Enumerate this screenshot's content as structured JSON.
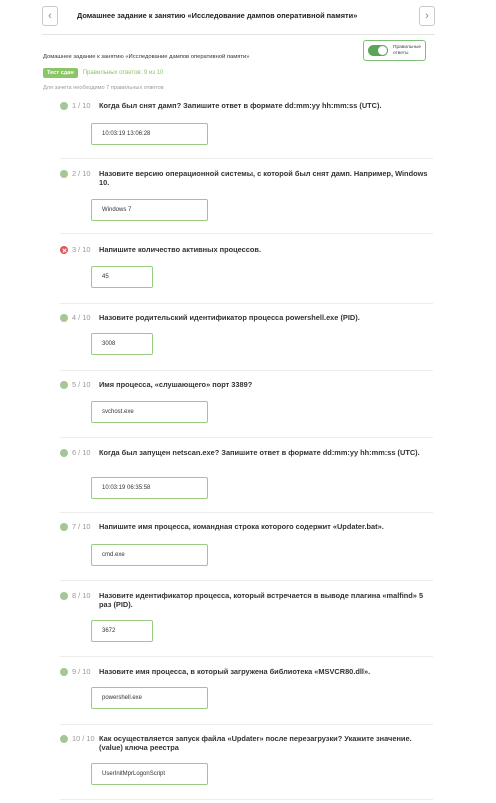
{
  "header": {
    "prev_icon": "chevron-left-icon",
    "next_icon": "chevron-right-icon",
    "title": "Домашнее задание к занятию «Исследование дампов оперативной памяти»"
  },
  "subtitle": "Домашнее задание к занятию «Исследование дампов оперативной памяти»",
  "toggle": {
    "label": "Правильные ответы",
    "on": true,
    "color": "#5aa55a"
  },
  "status": {
    "badge": "Тест сдан",
    "correct": "Правильных ответов: 9 из 10",
    "note": "Для зачета необходимо 7 правильных ответов"
  },
  "colors": {
    "correct": "#a6c695",
    "wrong": "#e05656",
    "answer_border": "#9acb84",
    "badge": "#8cc568"
  },
  "questions": [
    {
      "num": "1 / 10",
      "text": "Когда был снят дамп? Запишите ответ в формате dd:mm:yy hh:mm:ss (UTC).",
      "answer": "10:03:19 13:06:28",
      "status": "correct"
    },
    {
      "num": "2 / 10",
      "text": "Назовите версию операционной системы, с которой был снят дамп. Например, Windows 10.",
      "answer": "Windows 7",
      "status": "correct"
    },
    {
      "num": "3 / 10",
      "text": "Напишите количество активных процессов.",
      "answer": "45",
      "status": "wrong"
    },
    {
      "num": "4 / 10",
      "text": "Назовите родительский идентификатор процесса powershell.exe (PID).",
      "answer": "3008",
      "status": "correct"
    },
    {
      "num": "5 / 10",
      "text": "Имя процесса, «слушающего» порт 3389?",
      "answer": "svchost.exe",
      "status": "correct"
    },
    {
      "num": "6 / 10",
      "text": "Когда был запущен netscan.exe? Запишите ответ в формате dd:mm:yy hh:mm:ss (UTC).",
      "answer": "10:03:19 06:35:58",
      "status": "correct"
    },
    {
      "num": "7 / 10",
      "text": "Напишите имя процесса, командная строка которого содержит «Updater.bat».",
      "answer": "cmd.exe",
      "status": "correct"
    },
    {
      "num": "8 / 10",
      "text": "Назовите идентификатор процесса, который встречается в выводе плагина «malfind» 5 раз (PID).",
      "answer": "3672",
      "status": "correct"
    },
    {
      "num": "9 / 10",
      "text": "Назовите имя процесса, в который загружена библиотека «MSVCR80.dll».",
      "answer": "powershell.exe",
      "status": "correct"
    },
    {
      "num": "10 / 10",
      "text": "Как осуществляется запуск файла «Updater» после перезагрузки? Укажите значение. (value) ключа реестра",
      "answer": "UserInitMprLogonScript",
      "status": "correct"
    }
  ]
}
